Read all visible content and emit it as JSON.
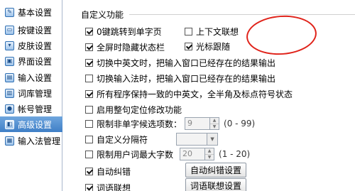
{
  "sidebar": {
    "items": [
      {
        "label": "基本设置",
        "icon": "wrench-icon",
        "glyph": "✎",
        "active": false
      },
      {
        "label": "按键设置",
        "icon": "keyboard-icon",
        "glyph": "▭",
        "active": false
      },
      {
        "label": "皮肤设置",
        "icon": "shirt-icon",
        "glyph": "▾",
        "active": false
      },
      {
        "label": "界面设置",
        "icon": "window-icon",
        "glyph": "▣",
        "active": false
      },
      {
        "label": "输入设置",
        "icon": "input-icon",
        "glyph": "▤",
        "active": false
      },
      {
        "label": "词库管理",
        "icon": "dictionary-icon",
        "glyph": "▥",
        "active": false
      },
      {
        "label": "帐号管理",
        "icon": "user-icon",
        "glyph": "●",
        "active": false
      },
      {
        "label": "高级设置",
        "icon": "advanced-icon",
        "glyph": "◧",
        "active": true
      },
      {
        "label": "输入法管理",
        "icon": "ime-manager-icon",
        "glyph": "▦",
        "active": false
      }
    ]
  },
  "panel": {
    "group_title": "自定义功能",
    "opt_zero_jump": {
      "label": "0键跳转到单字页",
      "checked": true
    },
    "opt_updown_assoc": {
      "label": "上下文联想",
      "checked": false
    },
    "opt_fullscreen_hide": {
      "label": "全屏时隐藏状态栏",
      "checked": true
    },
    "opt_cursor_follow": {
      "label": "光标跟随",
      "checked": true
    },
    "opt_switch_cn_en": {
      "label": "切换中英文时，把输入窗口已经存在的结果输出",
      "checked": true
    },
    "opt_switch_ime": {
      "label": "切换输入法时，把输入窗口已经存在的结果输出",
      "checked": false
    },
    "opt_all_programs": {
      "label": "所有程序保持一致的中英文，全半角及标点符号状态",
      "checked": true
    },
    "opt_sentence_edit": {
      "label": "启用整句定位修改功能",
      "checked": false
    },
    "opt_limit_candidates": {
      "label": "限制非单字候选项数：",
      "checked": false,
      "value": "9",
      "range": "(0 - 99)"
    },
    "opt_custom_separator": {
      "label": "自定义分隔符",
      "checked": false
    },
    "opt_limit_user_words": {
      "label": "限制用户词最大字数",
      "checked": false,
      "value": "20",
      "range": "(1 - 20)"
    },
    "opt_auto_correct": {
      "label": "自动纠错",
      "checked": true,
      "button": "自动纠错设置"
    },
    "opt_word_assoc": {
      "label": "词语联想",
      "checked": true,
      "button": "词语联想设置"
    }
  },
  "colors": {
    "accent": "#4a86c8",
    "annotation": "#e0231a"
  }
}
